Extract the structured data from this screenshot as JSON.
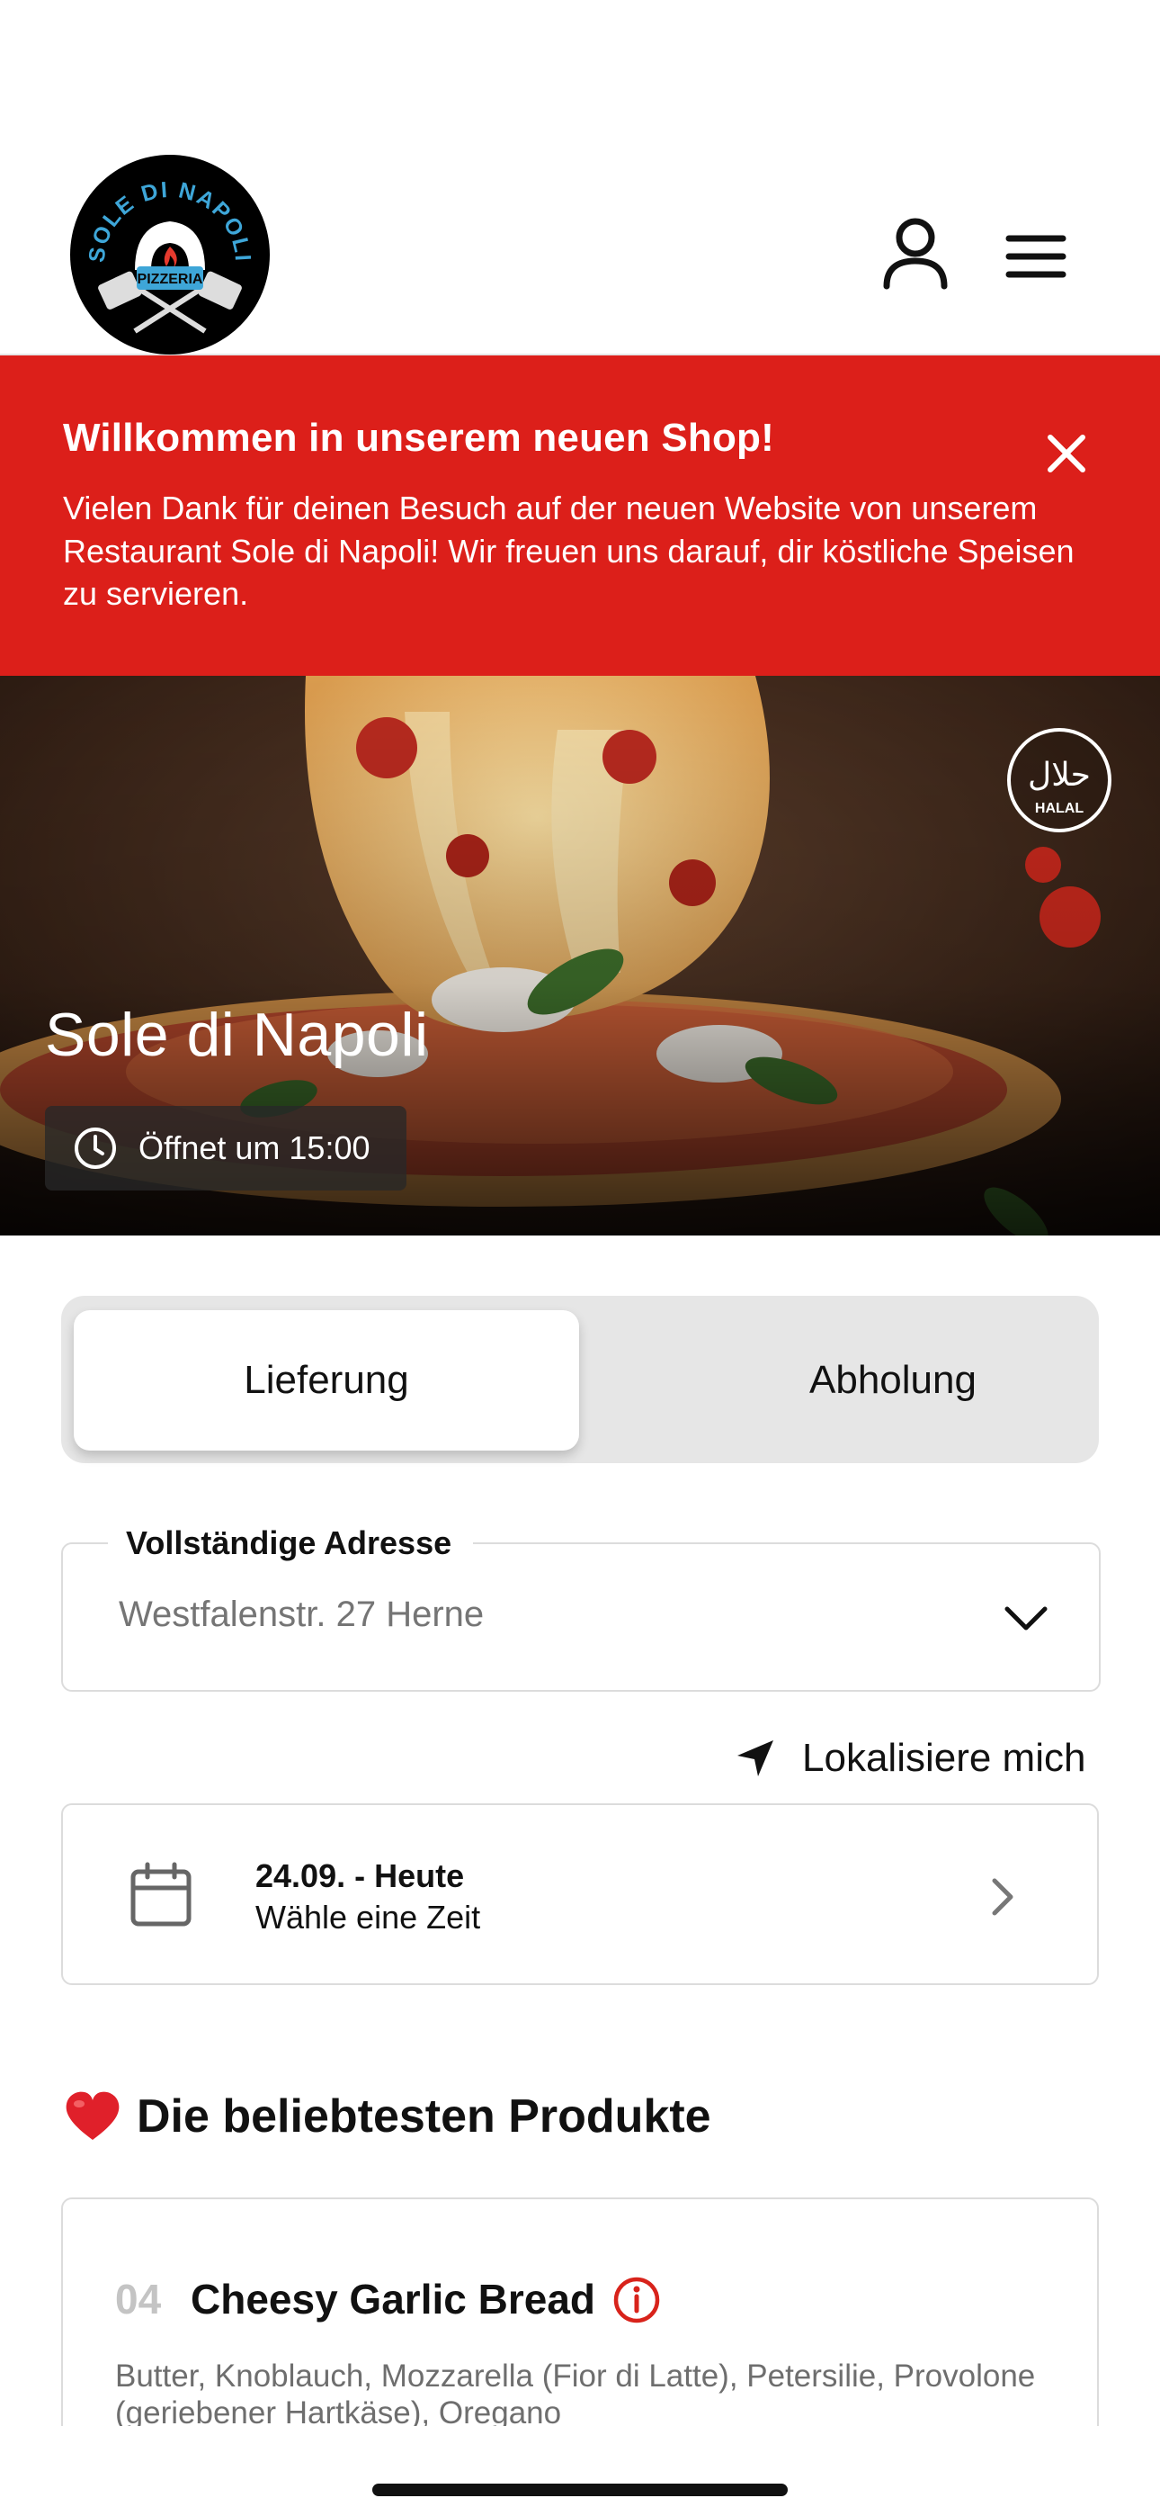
{
  "header": {
    "logo": {
      "top_text": "SOLE DI NAPOLI",
      "ribbon_text": "PIZZERIA",
      "icon": "pizza-oven-logo"
    },
    "user_icon": "user-icon",
    "menu_icon": "hamburger-menu-icon"
  },
  "banner": {
    "title": "Willkommen in unserem neuen Shop!",
    "text": "Vielen Dank für deinen Besuch auf der neuen Website von unserem Restaurant Sole di Napoli! Wir freuen uns darauf, dir köstliche Speisen zu servieren.",
    "close_icon": "close-icon",
    "color": "#dc1f1a"
  },
  "hero": {
    "title": "Sole di Napoli",
    "status": "Öffnet um 15:00",
    "halal_arabic": "حلال",
    "halal_label": "HALAL"
  },
  "order_mode": {
    "options": [
      "Lieferung",
      "Abholung"
    ],
    "selected": "Lieferung"
  },
  "address": {
    "label": "Vollständige Adresse",
    "placeholder": "Westfalenstr. 27 Herne",
    "value": ""
  },
  "locate": {
    "label": "Lokalisiere mich",
    "icon": "location-arrow-icon"
  },
  "schedule": {
    "date": "24.09. - Heute",
    "hint": "Wähle eine Zeit",
    "icon": "calendar-icon"
  },
  "popular": {
    "title": "Die beliebtesten Produkte",
    "icon": "heart-icon",
    "products": [
      {
        "number": "04",
        "name": "Cheesy Garlic Bread",
        "description": "Butter, Knoblauch, Mozzarella (Fior di Latte), Petersilie, Provolone (geriebener Hartkäse), Oregano"
      }
    ]
  },
  "colors": {
    "accent": "#dc1f1a",
    "border": "#dcdcdc",
    "toggle_bg": "#e6e6e6"
  }
}
